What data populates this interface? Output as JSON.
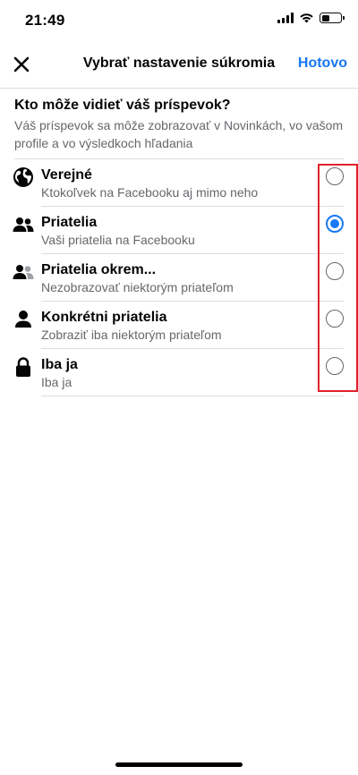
{
  "status_bar": {
    "time": "21:49"
  },
  "nav": {
    "title": "Vybrať nastavenie súkromia",
    "done_label": "Hotovo"
  },
  "intro": {
    "title": "Kto môže vidieť váš príspevok?",
    "description": "Váš príspevok sa môže zobrazovať v Novinkách, vo vašom profile a vo výsledkoch hľadania"
  },
  "options": [
    {
      "label": "Verejné",
      "sub": "Ktokoľvek na Facebooku aj mimo neho",
      "icon": "globe-icon",
      "selected": false
    },
    {
      "label": "Priatelia",
      "sub": "Vaši priatelia na Facebooku",
      "icon": "friends-icon",
      "selected": true
    },
    {
      "label": "Priatelia okrem...",
      "sub": "Nezobrazovať niektorým priateľom",
      "icon": "friends-except-icon",
      "selected": false
    },
    {
      "label": "Konkrétni priatelia",
      "sub": "Zobraziť iba niektorým priateľom",
      "icon": "person-icon",
      "selected": false
    },
    {
      "label": "Iba ja",
      "sub": "Iba ja",
      "icon": "lock-icon",
      "selected": false
    }
  ],
  "colors": {
    "accent": "#1877f2",
    "secondary_text": "#65676b",
    "highlight": "#e0202a"
  }
}
